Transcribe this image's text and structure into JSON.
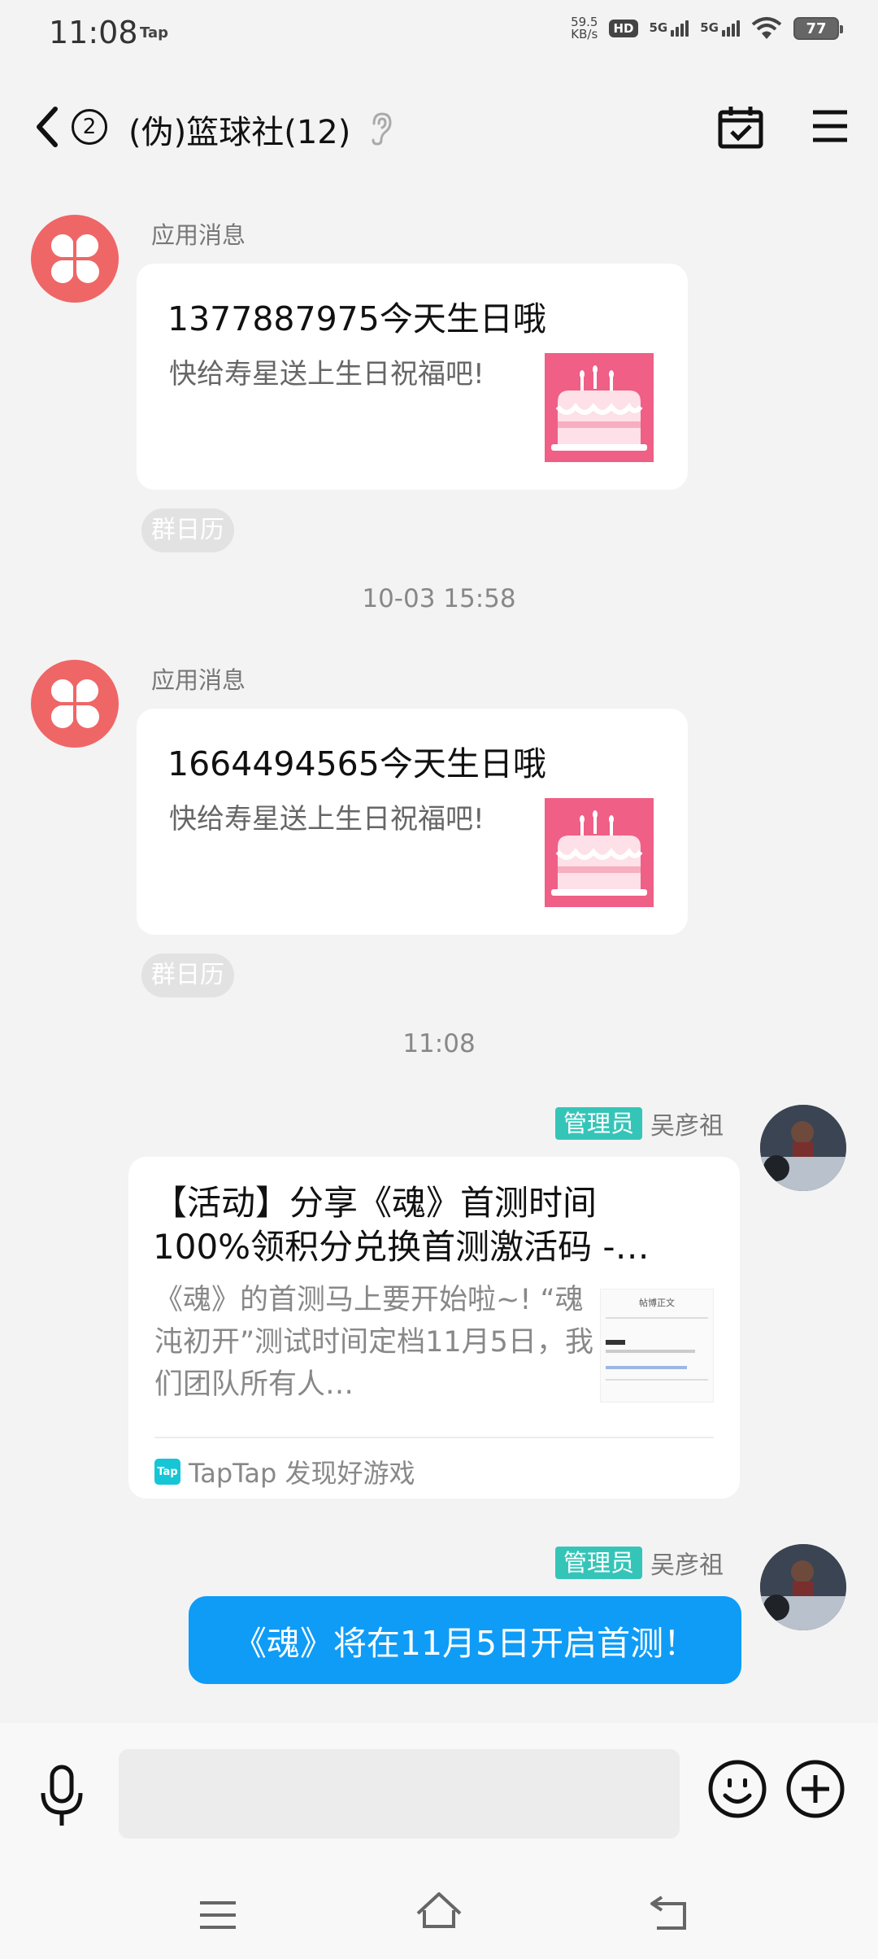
{
  "status_bar": {
    "time": "11:08",
    "app_badge": "Tap",
    "net_speed_value": "59.5",
    "net_speed_unit": "KB/s",
    "hd_badge": "HD",
    "sim1_label": "5G",
    "sim2_label": "5G",
    "battery": "77"
  },
  "header": {
    "unread_count": "2",
    "title": "(伪)篮球社(12)"
  },
  "messages": [
    {
      "sender": "应用消息",
      "title": "1377887975今天生日哦",
      "subtitle": "快给寿星送上生日祝福吧!",
      "tag": "群日历"
    },
    {
      "sender": "应用消息",
      "title": "1664494565今天生日哦",
      "subtitle": "快给寿星送上生日祝福吧!",
      "tag": "群日历"
    }
  ],
  "timestamps": [
    "10-03 15:58",
    "11:08"
  ],
  "share_message": {
    "role_badge": "管理员",
    "sender": "吴彦祖",
    "title": "【活动】分享《魂》首测时间100%领积分兑换首测激活码 -…",
    "description": "《魂》的首测马上要开始啦~! “魂沌初开”测试时间定档11月5日，我们团队所有人…",
    "thumbnail_heading": "帖博正文",
    "source_logo": "Tap",
    "source": "TapTap 发现好游戏"
  },
  "text_message": {
    "role_badge": "管理员",
    "sender": "吴彦祖",
    "text": "《魂》将在11月5日开启首测！"
  },
  "input": {
    "placeholder": ""
  }
}
